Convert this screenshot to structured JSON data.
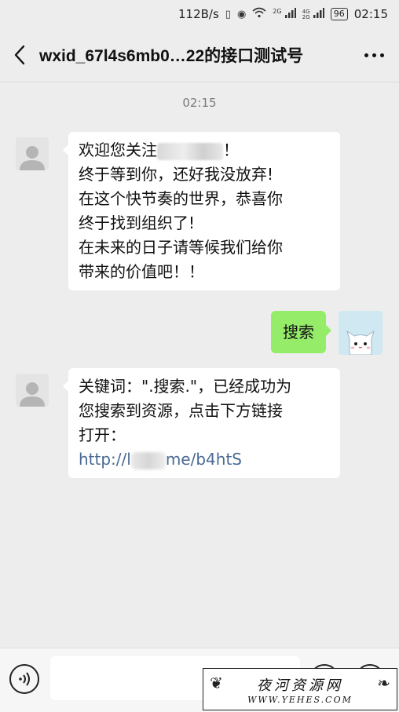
{
  "status_bar": {
    "speed": "112B/s",
    "network_labels": [
      "2G",
      "4G",
      "2G"
    ],
    "battery": "96",
    "time": "02:15"
  },
  "header": {
    "title": "wxid_67l4s6mb0…22的接口测试号"
  },
  "chat": {
    "timestamp": "02:15",
    "messages": [
      {
        "side": "left",
        "avatar": "default-user-icon",
        "lines": [
          {
            "before": "欢迎您关注",
            "after": "！"
          },
          "终于等到你，还好我没放弃!",
          "在这个快节奏的世界，恭喜你",
          "终于找到组织了!",
          "在未来的日子请等候我们给你",
          "带来的价值吧！！"
        ]
      },
      {
        "side": "right",
        "avatar": "cat-avatar",
        "text": "搜索"
      },
      {
        "side": "left",
        "avatar": "default-user-icon",
        "lines": [
          "关键词：\".搜索.\"，已经成功为",
          "您搜索到资源，点击下方链接",
          "打开："
        ],
        "link_before": "http://l",
        "link_after": "me/b4htS"
      }
    ]
  },
  "watermark": {
    "title": "夜河资源网",
    "url": "WWW.YEHES.COM"
  },
  "colors": {
    "background": "#ededed",
    "sent_bubble": "#95ec69",
    "received_bubble": "#ffffff",
    "link": "#4a6a93"
  }
}
